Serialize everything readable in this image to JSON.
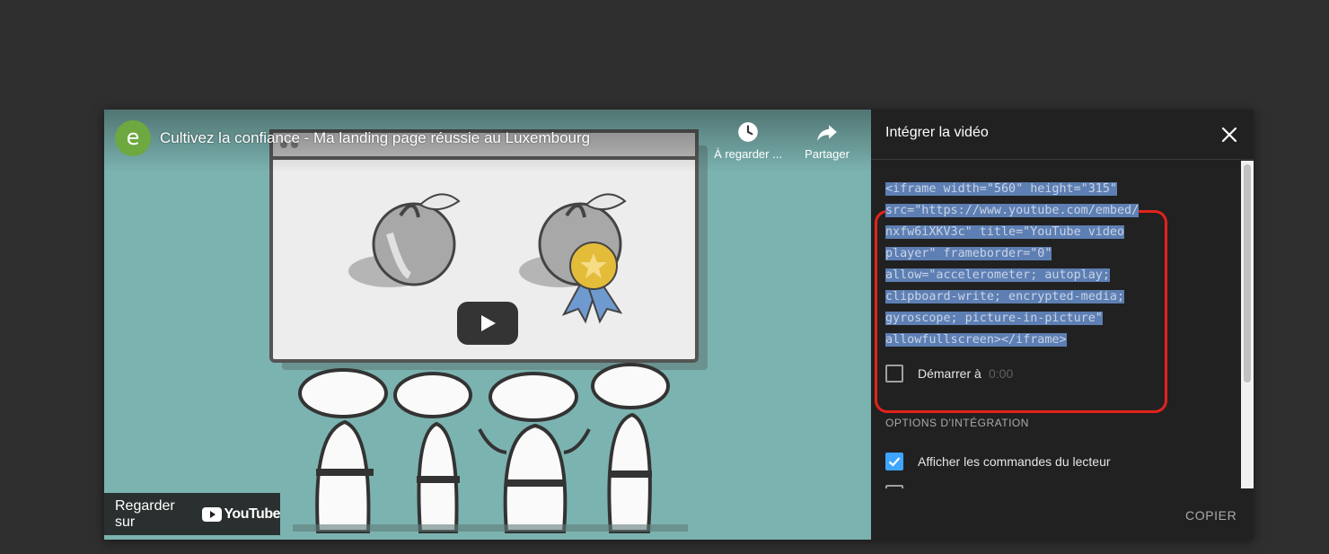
{
  "video": {
    "channel_initial": "e",
    "title": "Cultivez la confiance - Ma landing page réussie au Luxembourg",
    "watch_later_label": "À regarder ...",
    "share_label": "Partager",
    "watch_on_label": "Regarder sur",
    "youtube_logo_text": "YouTube"
  },
  "panel": {
    "title": "Intégrer la vidéo",
    "code_lines": [
      "<iframe width=\"560\" height=\"315\"",
      "src=\"https://www.youtube.com/embed/",
      "nxfw6iXKV3c\" title=\"YouTube video",
      "player\" frameborder=\"0\"",
      "allow=\"accelerometer; autoplay;",
      "clipboard-write; encrypted-media;",
      "gyroscope; picture-in-picture\"",
      "allowfullscreen></iframe>"
    ],
    "start_at_label": "Démarrer à",
    "start_at_value": "0:00",
    "options_heading": "OPTIONS D'INTÉGRATION",
    "show_controls_label": "Afficher les commandes du lecteur",
    "copy_label": "COPIER"
  },
  "colors": {
    "background": "#2f2f2f",
    "panel_bg": "#212121",
    "video_bg": "#7bb3b0",
    "selection": "#5d7fb3",
    "highlight_outline": "#e2231a",
    "checkbox_accent": "#3ea6ff",
    "channel_avatar": "#6ea840"
  }
}
